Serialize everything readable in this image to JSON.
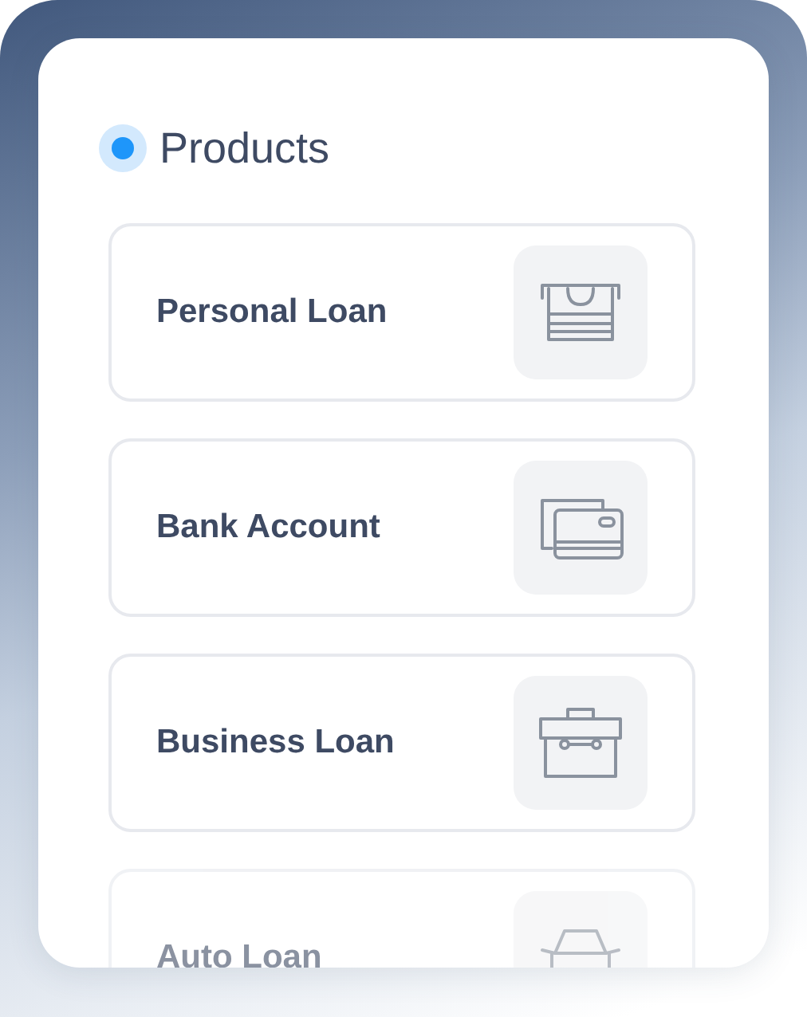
{
  "section": {
    "title": "Products",
    "active": true
  },
  "products": [
    {
      "label": "Personal Loan",
      "kind": "atm",
      "faded": false
    },
    {
      "label": "Bank Account",
      "kind": "cards",
      "faded": false
    },
    {
      "label": "Business Loan",
      "kind": "briefcase",
      "faded": false
    },
    {
      "label": "Auto Loan",
      "kind": "car",
      "faded": true
    }
  ]
}
